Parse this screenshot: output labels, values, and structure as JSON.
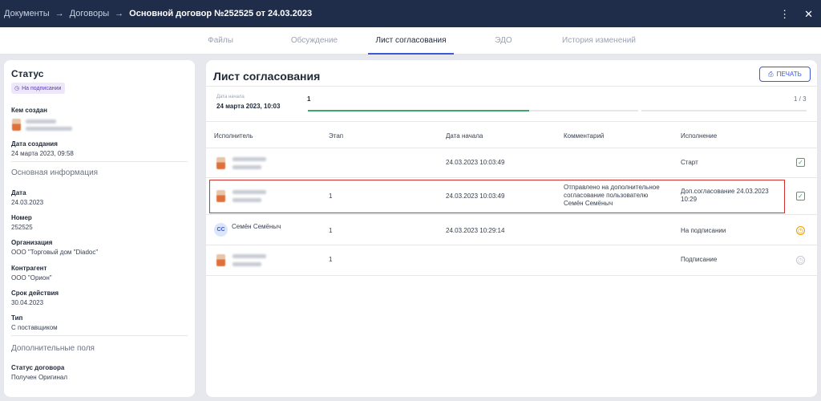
{
  "topbar": {
    "breadcrumbs": [
      "Документы",
      "Договоры"
    ],
    "separator": "→",
    "current": "Основной договор №252525 от 24.03.2023"
  },
  "tabs": [
    "Файлы",
    "Обсуждение",
    "Лист согласования",
    "ЭДО",
    "История изменений"
  ],
  "active_tab": "Лист согласования",
  "left_panel": {
    "title": "Статус",
    "status_badge": "На подписании",
    "created_by_label": "Кем создан",
    "created_date_label": "Дата создания",
    "created_date_value": "24 марта 2023, 09:58",
    "main_info_section": "Основная информация",
    "fields": [
      {
        "label": "Дата",
        "value": "24.03.2023"
      },
      {
        "label": "Номер",
        "value": "252525"
      },
      {
        "label": "Организация",
        "value": "ООО \"Торговый дом \"Diadoc\""
      },
      {
        "label": "Контрагент",
        "value": "ООО \"Орион\""
      },
      {
        "label": "Срок действия",
        "value": "30.04.2023"
      },
      {
        "label": "Тип",
        "value": "С поставщиком"
      }
    ],
    "extra_section": "Дополнительные поля",
    "contract_status_label": "Статус договора",
    "contract_status_value": "Получен Оригинал"
  },
  "main": {
    "title": "Лист согласования",
    "print_label": "ПЕЧАТЬ",
    "date_caption": "Дата начала",
    "date_value": "24 марта 2023, 10:03",
    "current_step": "1",
    "step_count": "1 / 3",
    "progress_fraction": 0.67,
    "columns": [
      "Исполнитель",
      "Этап",
      "Дата начала",
      "Комментарий",
      "Исполнение"
    ],
    "rows": [
      {
        "stage": "",
        "start": "24.03.2023 10:03:49",
        "comment": "",
        "execution": "Старт",
        "status": "done"
      },
      {
        "stage": "1",
        "start": "24.03.2023 10:03:49",
        "comment": [
          "Отправлено на дополнительное",
          "согласование пользователю",
          "Семён Семёныч"
        ],
        "execution": [
          "Доп.согласование 24.03.2023",
          "10:29"
        ],
        "status": "done"
      },
      {
        "initials": "СС",
        "name": "Семён Семёныч",
        "stage": "1",
        "start": "24.03.2023 10:29:14",
        "comment": "",
        "execution": "На подписании",
        "status": "pending"
      },
      {
        "stage": "1",
        "start": "",
        "comment": "",
        "execution": "Подписание",
        "status": "waiting"
      }
    ]
  }
}
